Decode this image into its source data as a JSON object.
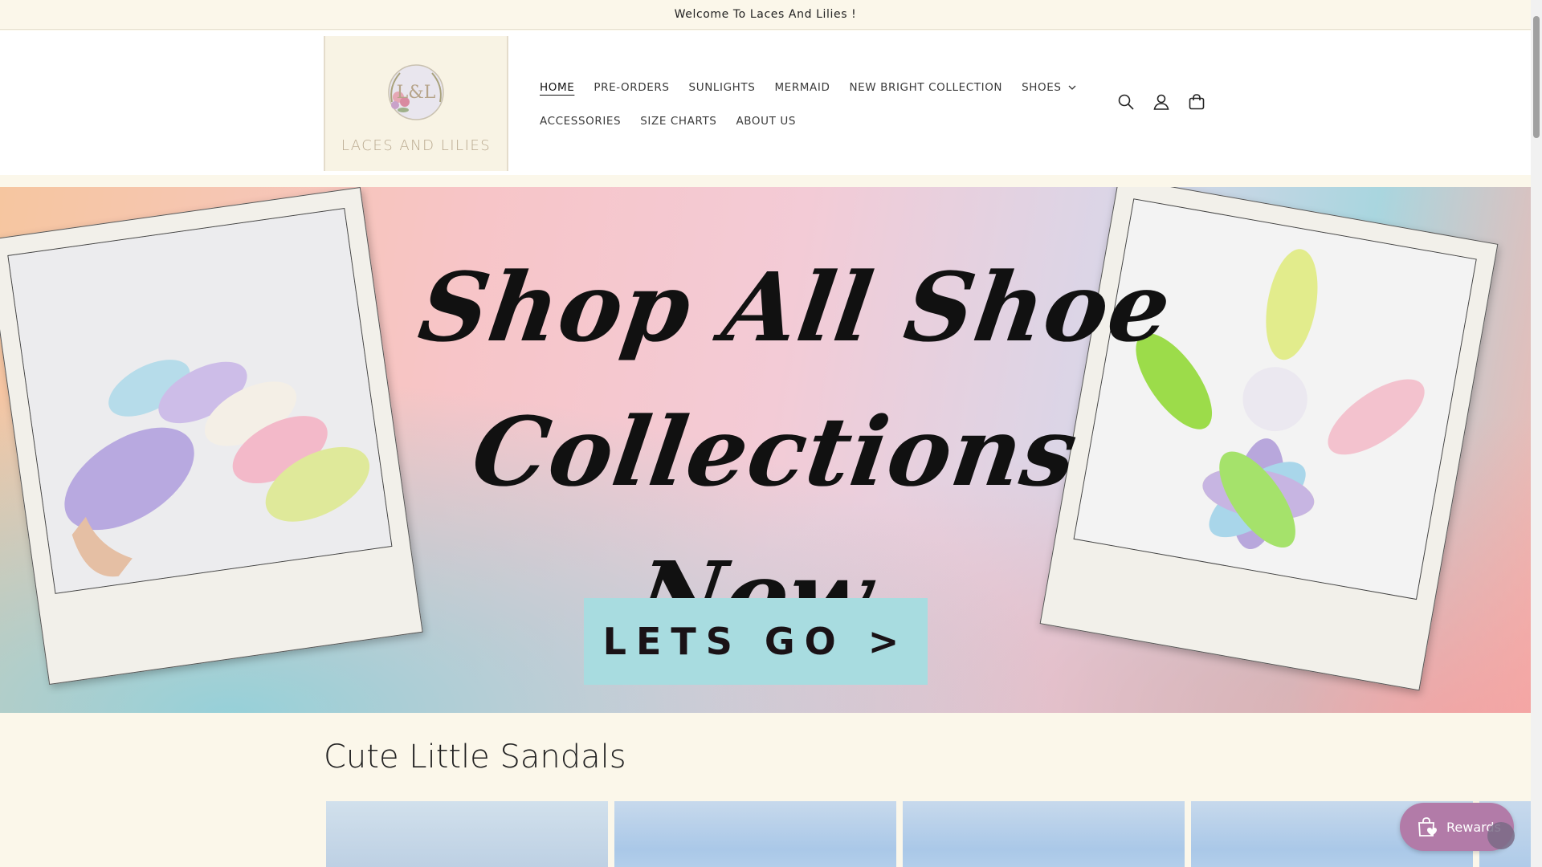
{
  "announcement": {
    "text": "Welcome To Laces And Lilies !"
  },
  "logo": {
    "monogram": "L&L",
    "text": "LACES AND LILIES"
  },
  "nav": {
    "row1": [
      {
        "label": "HOME",
        "active": true
      },
      {
        "label": "PRE-ORDERS"
      },
      {
        "label": "SUNLIGHTS"
      },
      {
        "label": "MERMAID"
      },
      {
        "label": "NEW BRIGHT COLLECTION"
      },
      {
        "label": "SHOES",
        "dropdown": true
      }
    ],
    "row2": [
      {
        "label": "ACCESSORIES"
      },
      {
        "label": "SIZE CHARTS"
      },
      {
        "label": "ABOUT US"
      }
    ]
  },
  "header_icons": [
    "search-icon",
    "account-icon",
    "cart-icon"
  ],
  "hero": {
    "title_line1": "Shop All Shoe",
    "title_line2": "Collections Now",
    "cta_label": "LETS GO >"
  },
  "section": {
    "title": "Cute Little Sandals"
  },
  "rewards": {
    "label": "Rewards"
  },
  "colors": {
    "page_bg": "#fbf7ea",
    "cta_bg": "#a8dce0",
    "rewards_bg": "#b27ba8"
  }
}
